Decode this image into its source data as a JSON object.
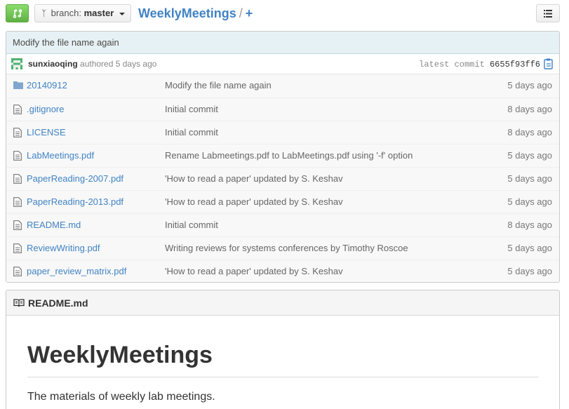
{
  "toolbar": {
    "compare_icon": "compare-icon",
    "branch_label": "branch:",
    "branch_value": "master",
    "repo_name": "WeeklyMeetings",
    "path_separator": "/",
    "add_file": "+",
    "list_icon": "list-icon"
  },
  "commit": {
    "message": "Modify the file name again",
    "author": "sunxiaoqing",
    "authored": "authored 5 days ago",
    "latest_label": "latest commit",
    "sha": "6655f93ff6"
  },
  "files": [
    {
      "name": "20140912",
      "type": "folder",
      "message": "Modify the file name again",
      "age": "5 days ago"
    },
    {
      "name": ".gitignore",
      "type": "file",
      "message": "Initial commit",
      "age": "8 days ago"
    },
    {
      "name": "LICENSE",
      "type": "file",
      "message": "Initial commit",
      "age": "8 days ago"
    },
    {
      "name": "LabMeetings.pdf",
      "type": "file",
      "message": "Rename Labmeetings.pdf to LabMeetings.pdf using '-f' option",
      "age": "5 days ago"
    },
    {
      "name": "PaperReading-2007.pdf",
      "type": "file",
      "message": "'How to read a paper' updated by S. Keshav",
      "age": "5 days ago"
    },
    {
      "name": "PaperReading-2013.pdf",
      "type": "file",
      "message": "'How to read a paper' updated by S. Keshav",
      "age": "5 days ago"
    },
    {
      "name": "README.md",
      "type": "file",
      "message": "Initial commit",
      "age": "8 days ago"
    },
    {
      "name": "ReviewWriting.pdf",
      "type": "file",
      "message": "Writing reviews for systems conferences by Timothy Roscoe",
      "age": "5 days ago"
    },
    {
      "name": "paper_review_matrix.pdf",
      "type": "file",
      "message": "'How to read a paper' updated by S. Keshav",
      "age": "5 days ago"
    }
  ],
  "readme": {
    "title": "README.md",
    "heading": "WeeklyMeetings",
    "body": "The materials of weekly lab meetings."
  },
  "colors": {
    "link": "#4183c4",
    "compare_button": "#60b044",
    "commit_bar": "#e6f1f6"
  }
}
